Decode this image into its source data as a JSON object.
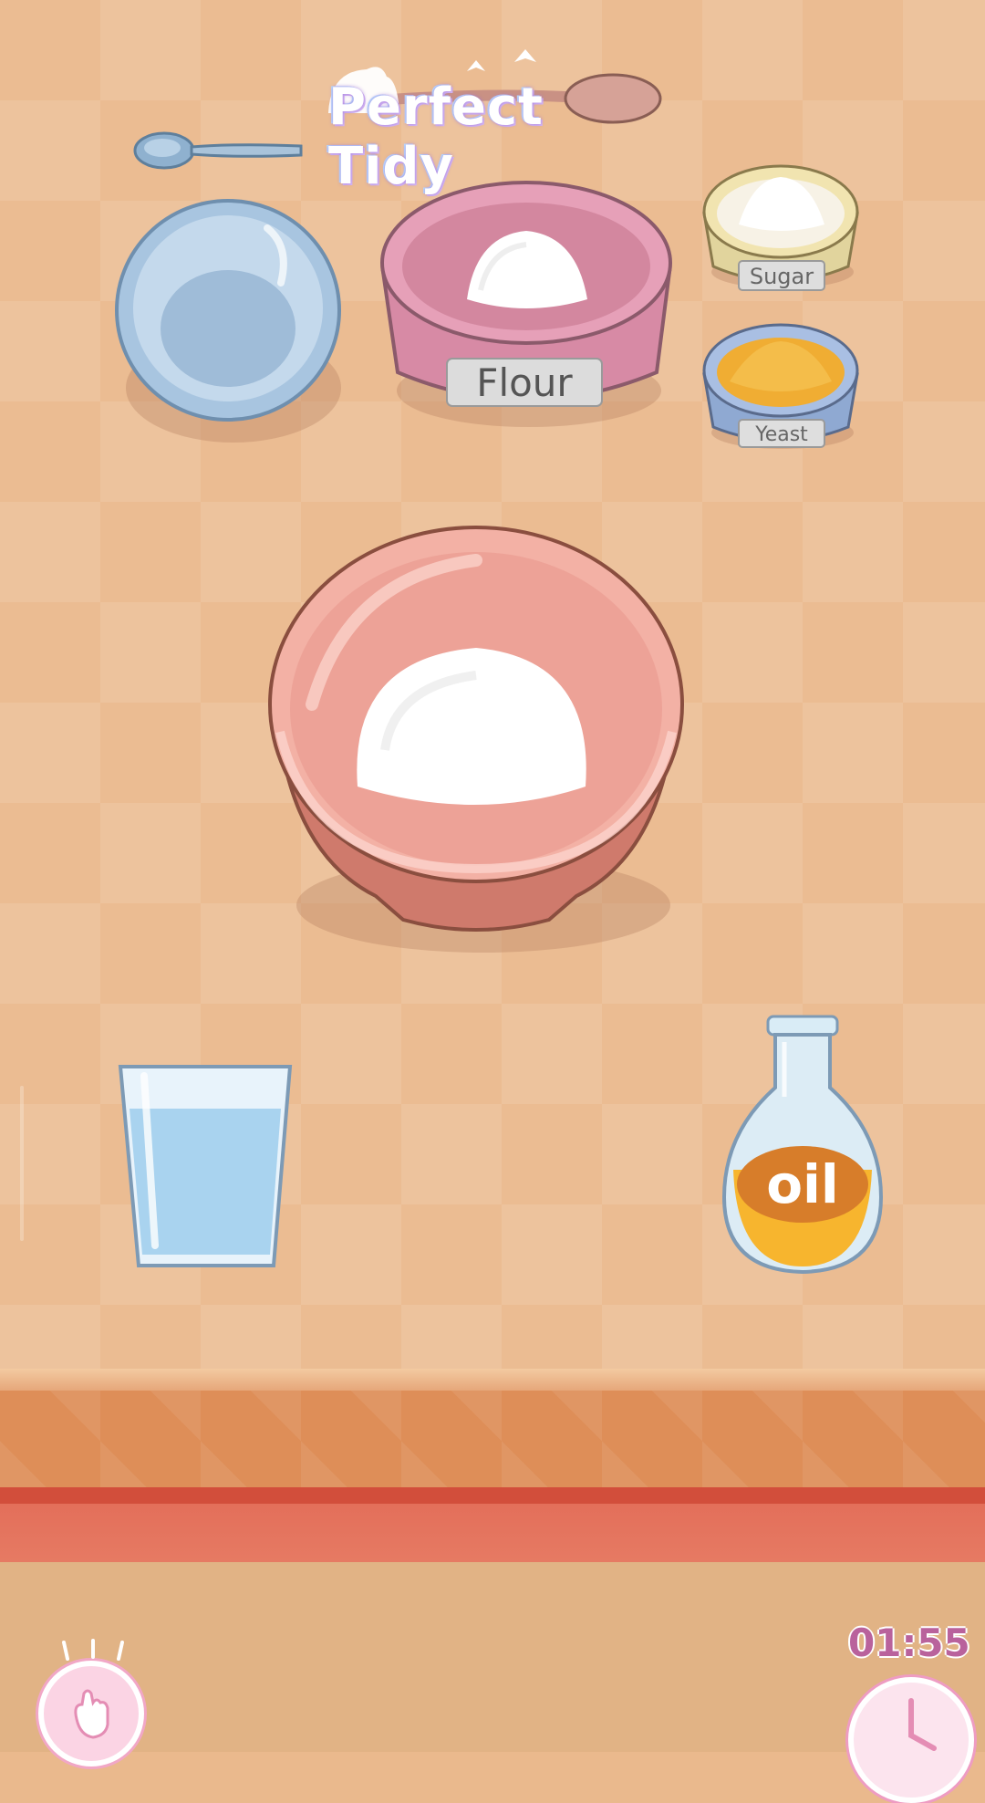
{
  "game": {
    "watermark": "Perfect Tidy",
    "timer": "01:55"
  },
  "ingredients": {
    "flour_label": "Flour",
    "sugar_label": "Sugar",
    "yeast_label": "Yeast",
    "oil_label": "oil"
  },
  "items": {
    "spoon": "spoon",
    "empty_bowl": "empty-blue-bowl",
    "mixing_bowl": "mixing-bowl-with-flour",
    "water_glass": "glass-of-water",
    "oil_bottle": "oil-bottle"
  },
  "colors": {
    "table": "#ebbc92",
    "counter": "#de8e58",
    "stripe": "#d24e3b",
    "floor": "#e1b385",
    "timer": "#b9629c"
  },
  "icons": {
    "hint": "hand-pointer-icon",
    "timer": "alarm-clock-icon"
  }
}
